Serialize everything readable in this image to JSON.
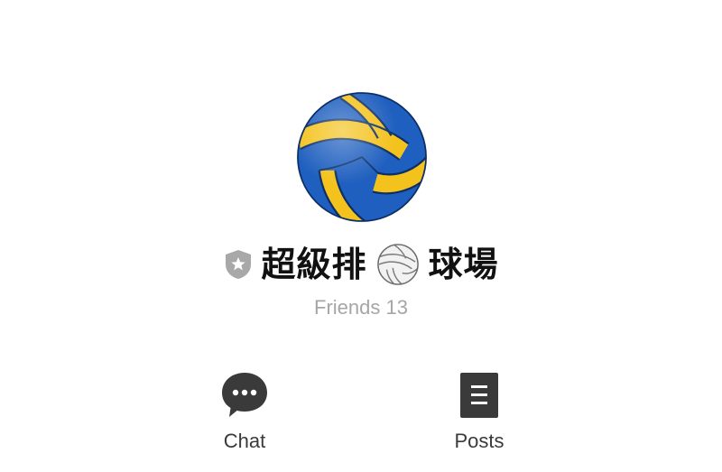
{
  "profile": {
    "name_prefix": "超級排",
    "name_suffix": "球場",
    "friends_label": "Friends 13"
  },
  "actions": [
    {
      "label": "Chat",
      "icon": "chat-bubble-icon"
    },
    {
      "label": "Posts",
      "icon": "posts-document-icon"
    }
  ],
  "colors": {
    "ball_blue": "#1f5fbf",
    "ball_yellow": "#f4c21c",
    "icon_dark": "#3a3a3a",
    "muted_text": "#a6a6a6",
    "shield_gray": "#a8a8a8"
  }
}
